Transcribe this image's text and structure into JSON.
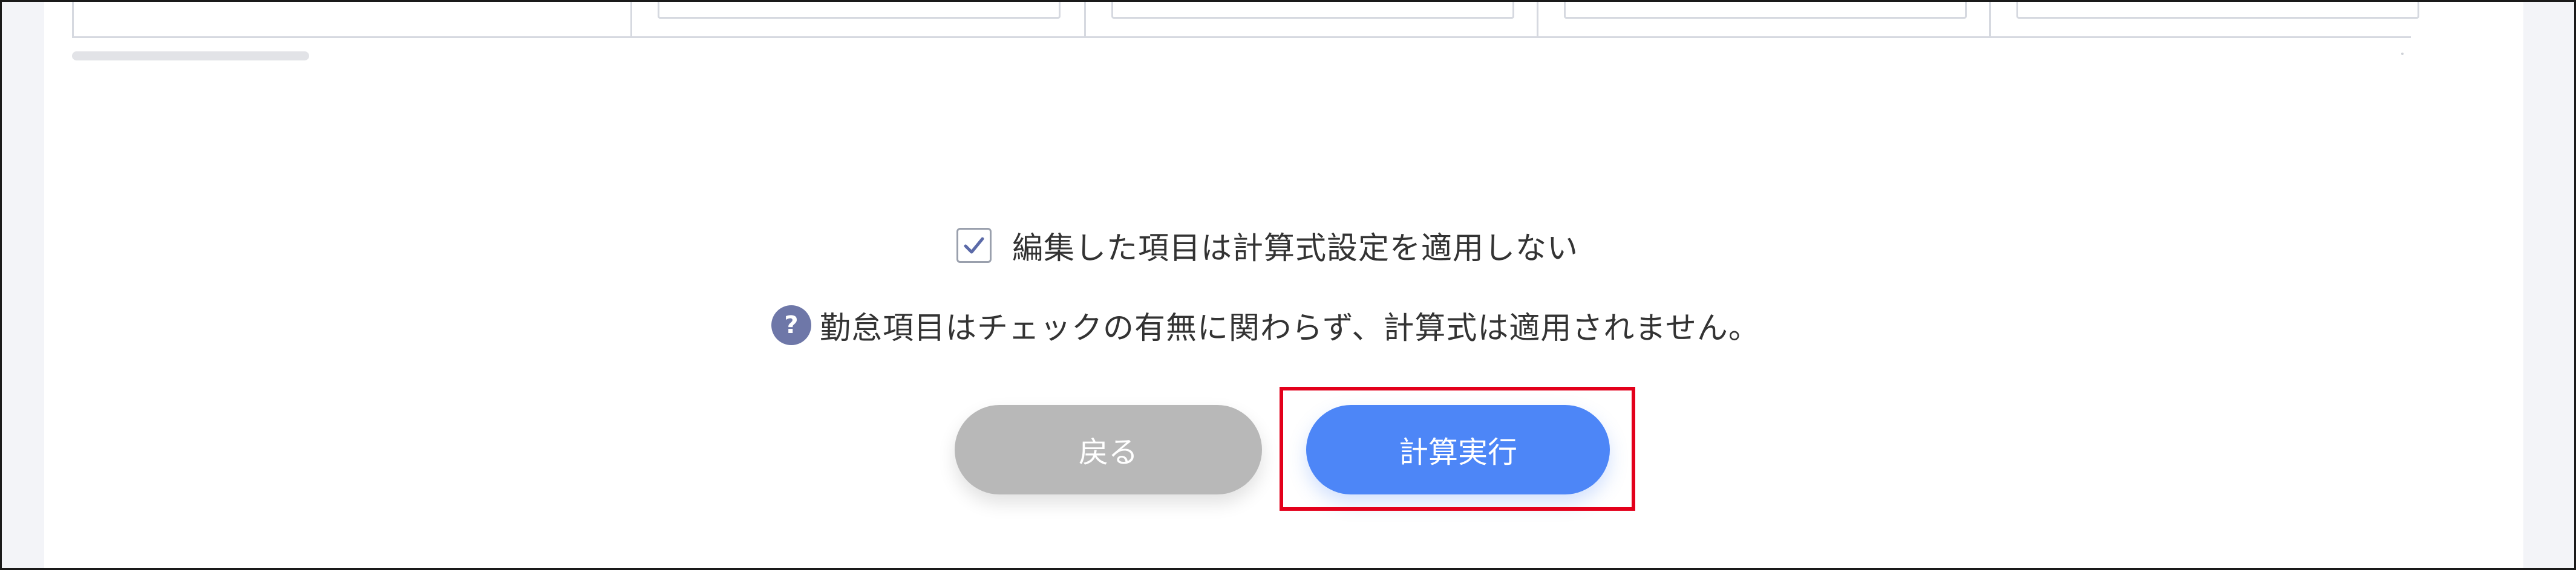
{
  "options": {
    "no_formula_checkbox_label": "編集した項目は計算式設定を適用しない",
    "no_formula_checked": true
  },
  "note": {
    "help_glyph": "?",
    "text": "勤怠項目はチェックの有無に関わらず、計算式は適用されません。"
  },
  "actions": {
    "back_label": "戻る",
    "run_label": "計算実行"
  },
  "colors": {
    "primary_button": "#4d86f7",
    "secondary_button": "#b8b8b8",
    "highlight": "#e3001b",
    "help_icon": "#6e77a8"
  },
  "icons": {
    "checkbox": "check-icon",
    "help": "question-circle-icon"
  }
}
